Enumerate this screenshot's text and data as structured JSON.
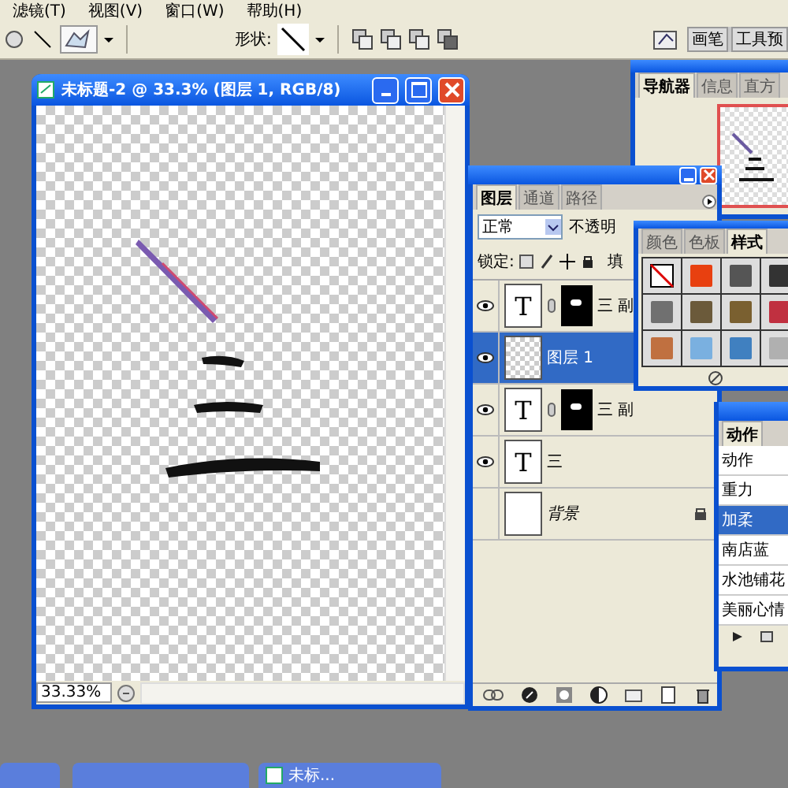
{
  "menu_bar": [
    "滤镜(T)",
    "视图(V)",
    "窗口(W)",
    "帮助(H)"
  ],
  "options_bar": {
    "shape_label": "形状:"
  },
  "palette_well": {
    "tabs": [
      "画笔",
      "工具预"
    ]
  },
  "document": {
    "title": "未标题-2 @ 33.3% (图层 1, RGB/8)",
    "zoom": "33.33%"
  },
  "navigator": {
    "tabs": [
      {
        "label": "导航器",
        "selected": true
      },
      {
        "label": "信息",
        "selected": false
      },
      {
        "label": "直方",
        "selected": false
      }
    ]
  },
  "layers_panel": {
    "tabs": [
      {
        "label": "图层",
        "selected": true
      },
      {
        "label": "通道",
        "selected": false
      },
      {
        "label": "路径",
        "selected": false
      }
    ],
    "blend_mode": "正常",
    "opacity_label": "不透明",
    "lock_label": "锁定:",
    "fill_label": "填",
    "layers": [
      {
        "name": "三 副",
        "kind": "text",
        "thumbnail": "T",
        "visible": true,
        "mask": true,
        "selected": false,
        "locked": false
      },
      {
        "name": "图层 1",
        "kind": "pixel",
        "visible": true,
        "mask": false,
        "selected": true,
        "locked": false
      },
      {
        "name": "三 副",
        "kind": "text",
        "thumbnail": "T",
        "visible": true,
        "mask": true,
        "selected": false,
        "locked": false
      },
      {
        "name": "三",
        "kind": "text",
        "thumbnail": "T",
        "visible": true,
        "mask": false,
        "selected": false,
        "locked": false
      },
      {
        "name": "背景",
        "kind": "background",
        "visible": false,
        "mask": false,
        "selected": false,
        "locked": true
      }
    ]
  },
  "styles_panel": {
    "tabs": [
      {
        "label": "颜色",
        "selected": false
      },
      {
        "label": "色板",
        "selected": false
      },
      {
        "label": "样式",
        "selected": true
      }
    ]
  },
  "actions_panel": {
    "tab": "动作",
    "items": [
      {
        "name": "动作",
        "selected": false
      },
      {
        "name": "重力",
        "selected": false
      },
      {
        "name": "加柔",
        "selected": true
      },
      {
        "name": "南店蓝",
        "selected": false
      },
      {
        "name": "水池铺花",
        "selected": false
      },
      {
        "name": "美丽心情",
        "selected": false
      }
    ]
  },
  "minimized_windows": [
    {
      "title": "未标..."
    }
  ]
}
